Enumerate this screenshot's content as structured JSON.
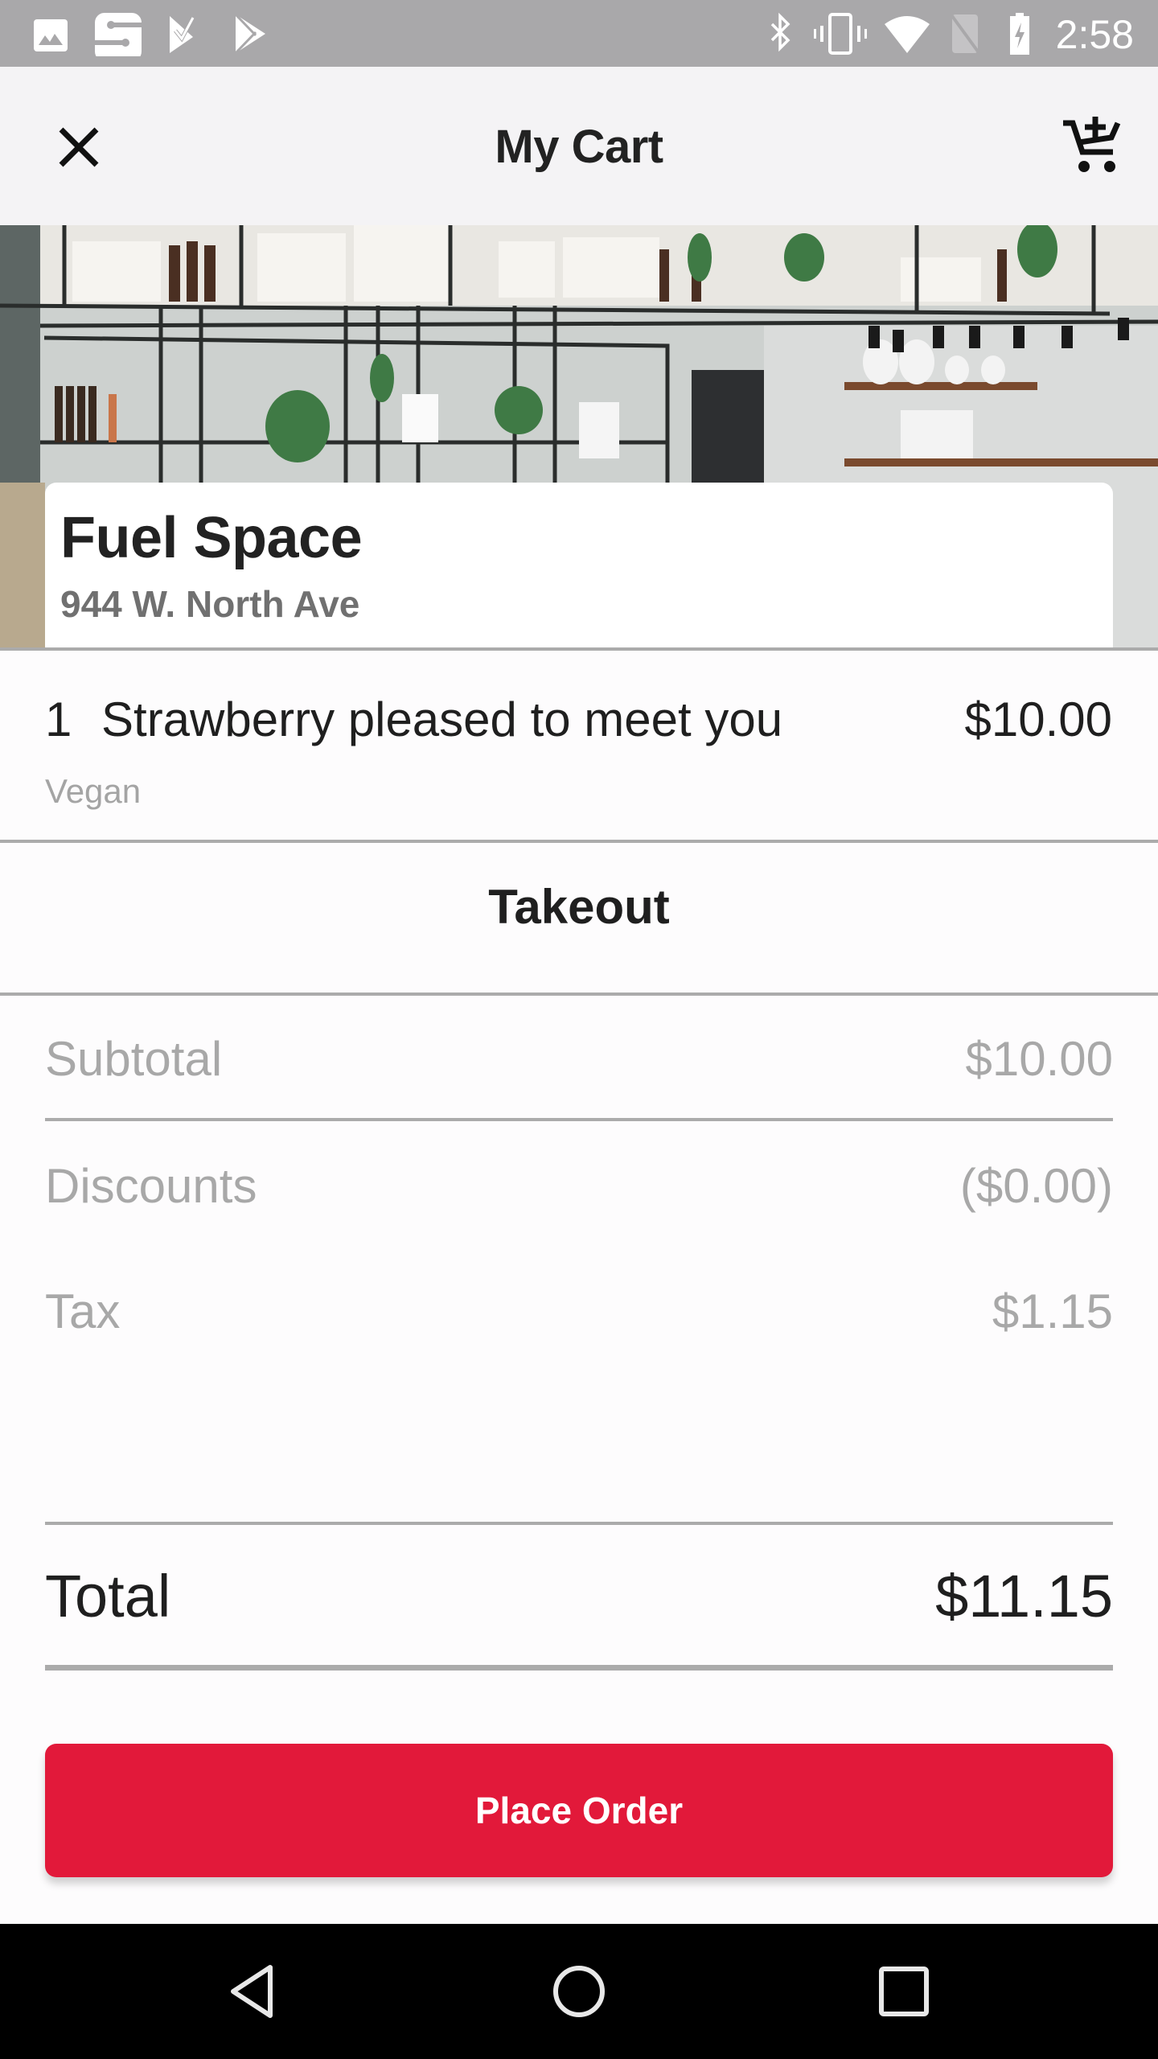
{
  "status_bar": {
    "time": "2:58",
    "left_icons": [
      "gallery-icon",
      "s-app-icon",
      "play-games-check-icon",
      "play-store-icon"
    ],
    "right_icons": [
      "bluetooth-icon",
      "vibrate-icon",
      "wifi-icon",
      "no-sim-icon",
      "battery-charging-icon"
    ]
  },
  "app_bar": {
    "title": "My Cart",
    "left_icon": "close-icon",
    "right_icon": "add-to-cart-icon"
  },
  "restaurant": {
    "name": "Fuel Space",
    "address": "944 W. North Ave"
  },
  "cart": {
    "items": [
      {
        "quantity": "1",
        "name": "Strawberry pleased to meet you",
        "price": "$10.00",
        "modifier": "Vegan"
      }
    ]
  },
  "order_type": "Takeout",
  "summary": {
    "subtotal_label": "Subtotal",
    "subtotal_value": "$10.00",
    "discounts_label": "Discounts",
    "discounts_value": "($0.00)",
    "tax_label": "Tax",
    "tax_value": "$1.15",
    "total_label": "Total",
    "total_value": "$11.15"
  },
  "actions": {
    "place_order_label": "Place Order"
  },
  "colors": {
    "accent": "#e2193a",
    "status_bar": "#a9a8aa",
    "app_bar": "#f4f3f5",
    "muted_text": "#a8a8a8",
    "divider": "#ababab"
  },
  "nav_bar": {
    "buttons": [
      "back-icon",
      "home-icon",
      "recents-icon"
    ]
  }
}
